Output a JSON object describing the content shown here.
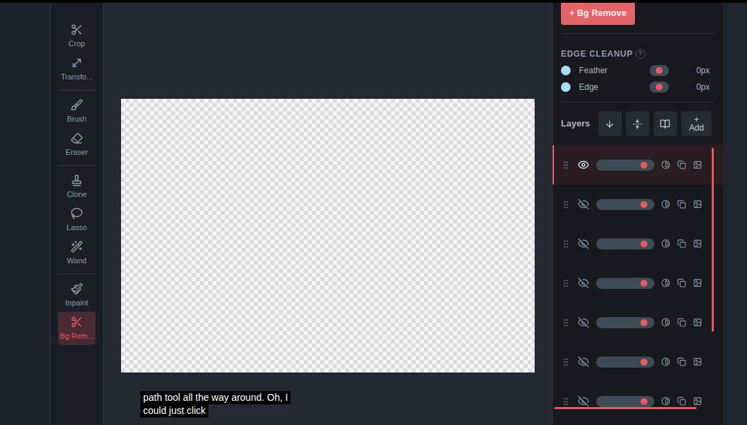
{
  "toolbar": {
    "tools": [
      {
        "label": "Crop",
        "selected": false
      },
      {
        "label": "Transfo...",
        "selected": false
      },
      {
        "label": "Brush",
        "selected": false
      },
      {
        "label": "Eraser",
        "selected": false
      },
      {
        "label": "Clone",
        "selected": false
      },
      {
        "label": "Lasso",
        "selected": false
      },
      {
        "label": "Wand",
        "selected": false
      },
      {
        "label": "Inpaint",
        "selected": false
      },
      {
        "label": "Bg Rem...",
        "selected": true
      }
    ]
  },
  "panel": {
    "bg_remove_button": "+ Bg Remove",
    "edge_cleanup": {
      "title": "EDGE CLEANUP",
      "help": "?",
      "controls": [
        {
          "label": "Feather",
          "value": "0px",
          "level": 0.5
        },
        {
          "label": "Edge",
          "value": "0px",
          "level": 0.5
        }
      ]
    }
  },
  "layers": {
    "title": "Layers",
    "add_icon": "+",
    "add_label": "Add",
    "rows": [
      {
        "visible": true,
        "selected": true,
        "level": 0.82
      },
      {
        "visible": false,
        "selected": false,
        "level": 0.82
      },
      {
        "visible": false,
        "selected": false,
        "level": 0.82
      },
      {
        "visible": false,
        "selected": false,
        "level": 0.82
      },
      {
        "visible": false,
        "selected": false,
        "level": 0.82
      },
      {
        "visible": false,
        "selected": false,
        "level": 0.82
      },
      {
        "visible": false,
        "selected": false,
        "level": 0.82
      }
    ]
  },
  "subtitle": {
    "lines": [
      "path tool all the way around. Oh, I",
      "could just click"
    ]
  }
}
